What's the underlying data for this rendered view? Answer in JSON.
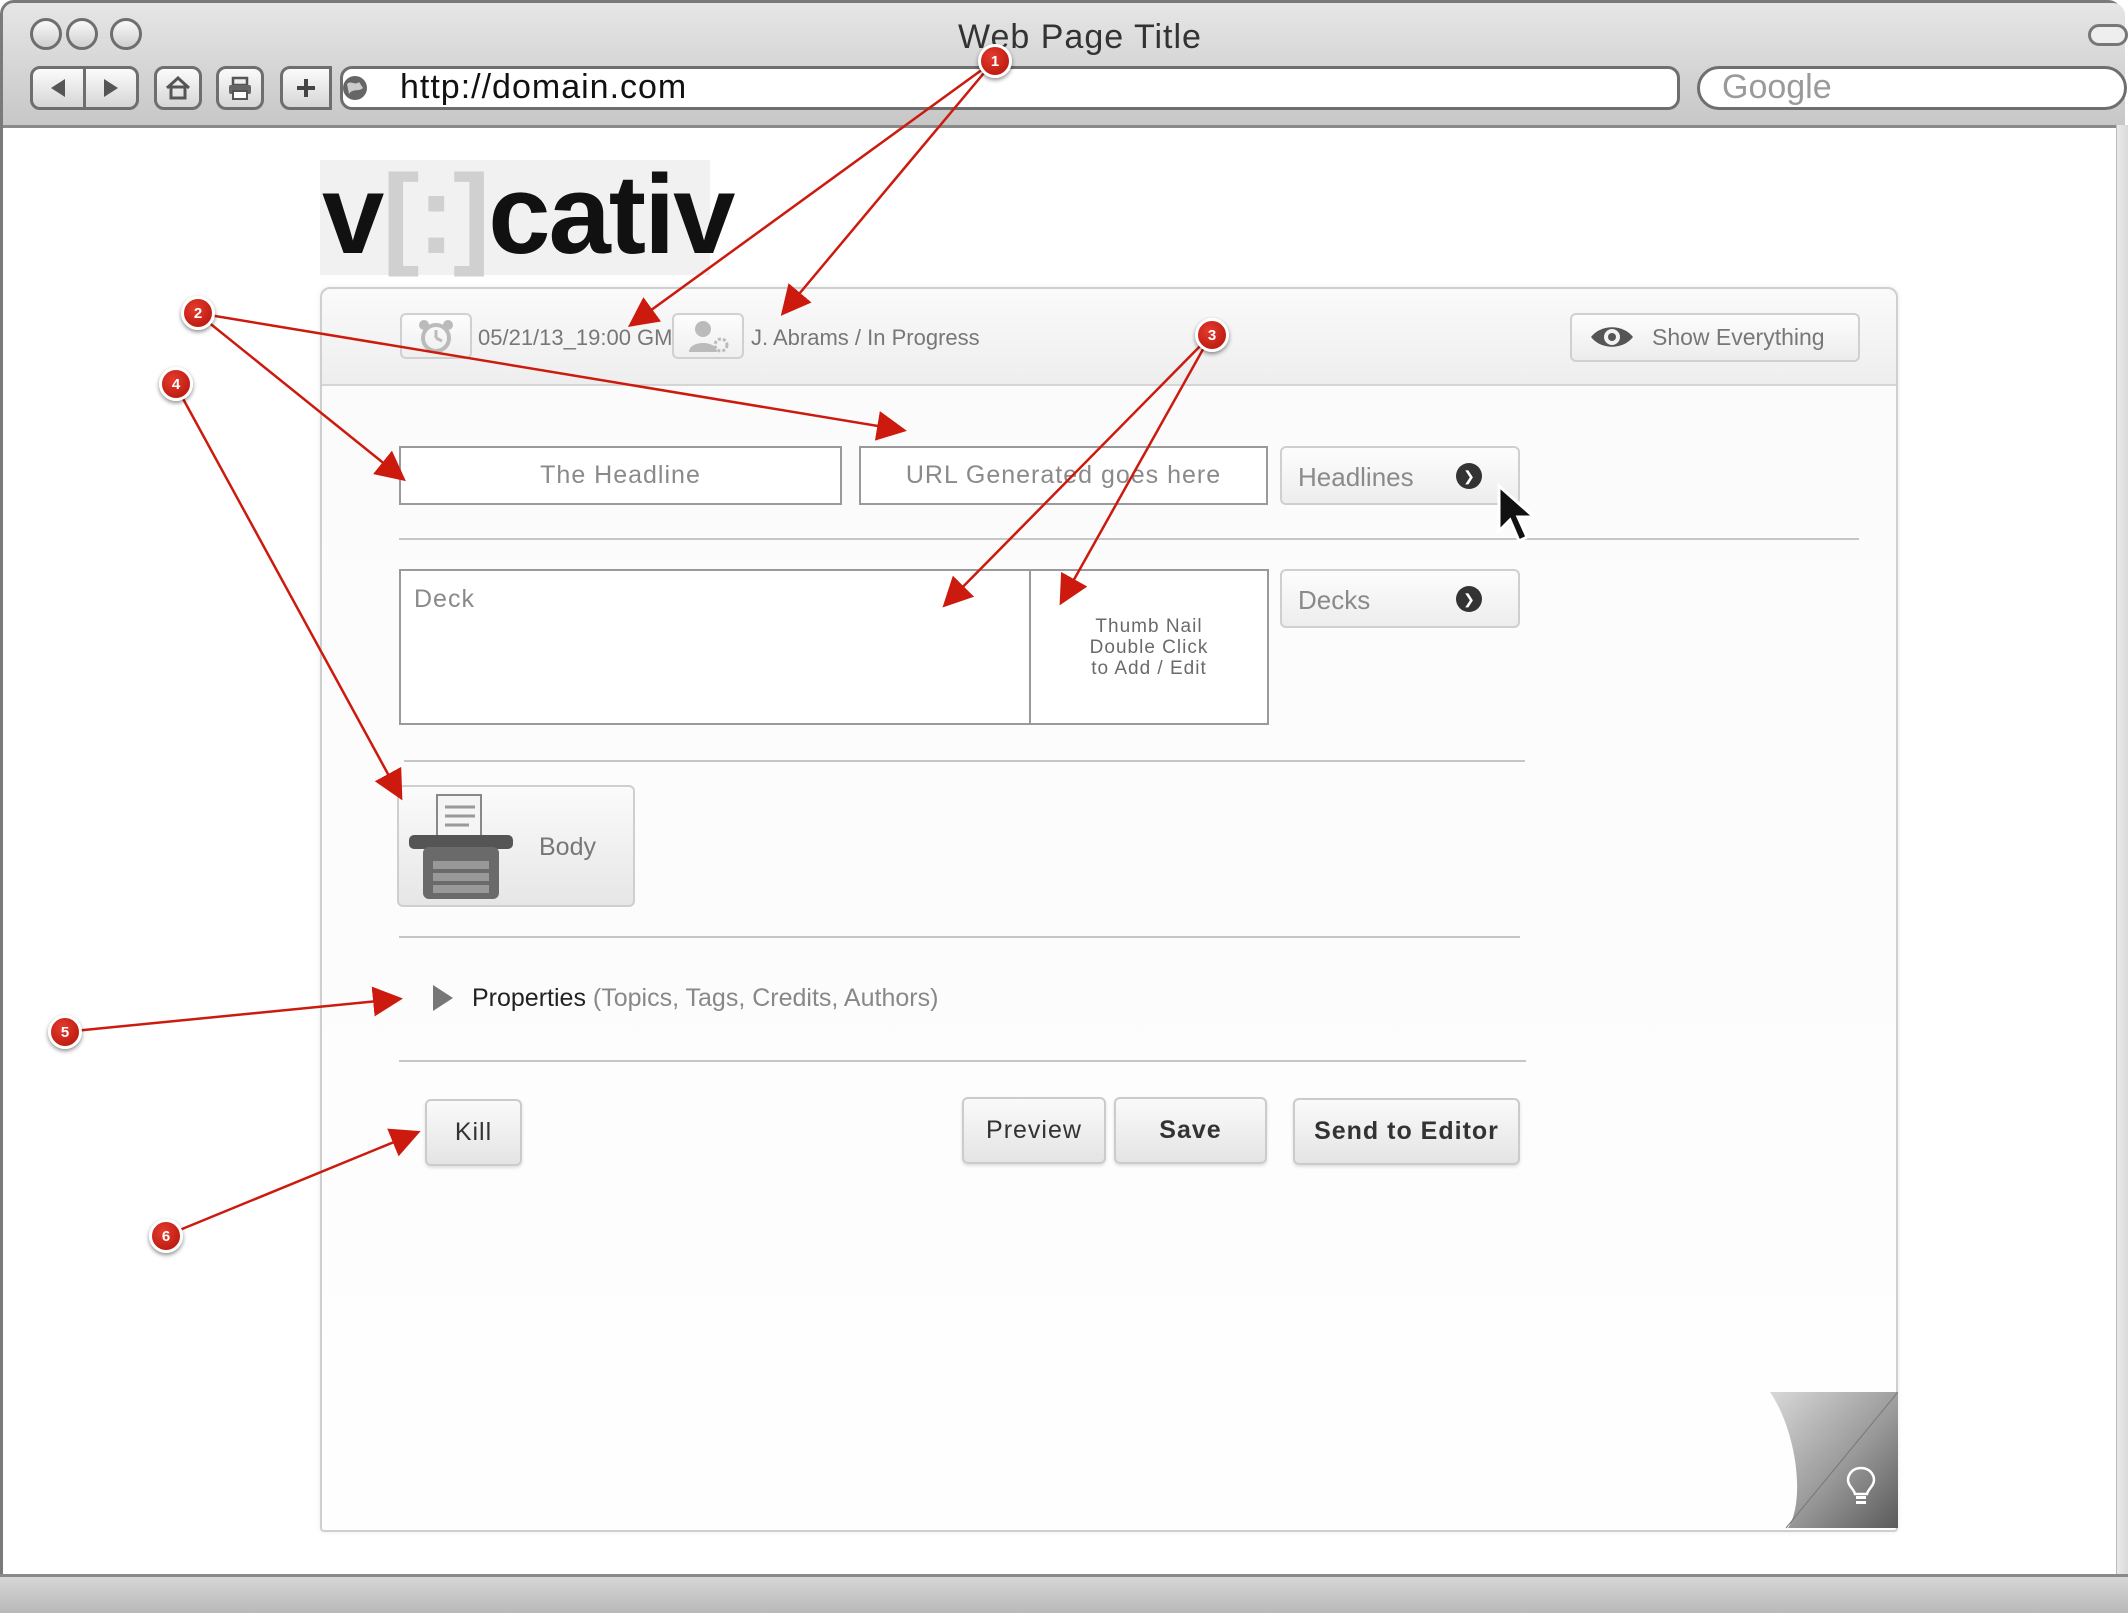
{
  "browser": {
    "window_title": "Web Page Title",
    "url": "http://domain.com",
    "search_placeholder": "Google"
  },
  "logo": {
    "v": "v",
    "bracket": "[:]",
    "rest": "cativ"
  },
  "header": {
    "timestamp": "05/21/13_19:00 GMT",
    "author_status": "J. Abrams / In Progress",
    "show_everything_label": "Show Everything"
  },
  "form": {
    "headline_placeholder": "The Headline",
    "url_placeholder": "URL Generated goes here",
    "headlines_dropdown": "Headlines",
    "deck_placeholder": "Deck",
    "thumbnail_line1": "Thumb Nail",
    "thumbnail_line2": "Double Click",
    "thumbnail_line3": "to Add / Edit",
    "decks_dropdown": "Decks",
    "body_label": "Body",
    "properties_label": "Properties",
    "properties_hint": "(Topics, Tags, Credits, Authors)"
  },
  "actions": {
    "kill": "Kill",
    "preview": "Preview",
    "save": "Save",
    "send_to_editor": "Send to Editor"
  },
  "annotations": [
    "1",
    "2",
    "3",
    "4",
    "5",
    "6"
  ],
  "colors": {
    "annotation_red": "#cc1a0e",
    "arrow_red": "#cc1a0e"
  },
  "icons": [
    "alarm-clock-icon",
    "user-settings-icon",
    "eye-icon",
    "chevron-down-icon",
    "typewriter-icon",
    "disclosure-triangle-icon",
    "lightbulb-icon",
    "mouse-cursor-icon"
  ]
}
